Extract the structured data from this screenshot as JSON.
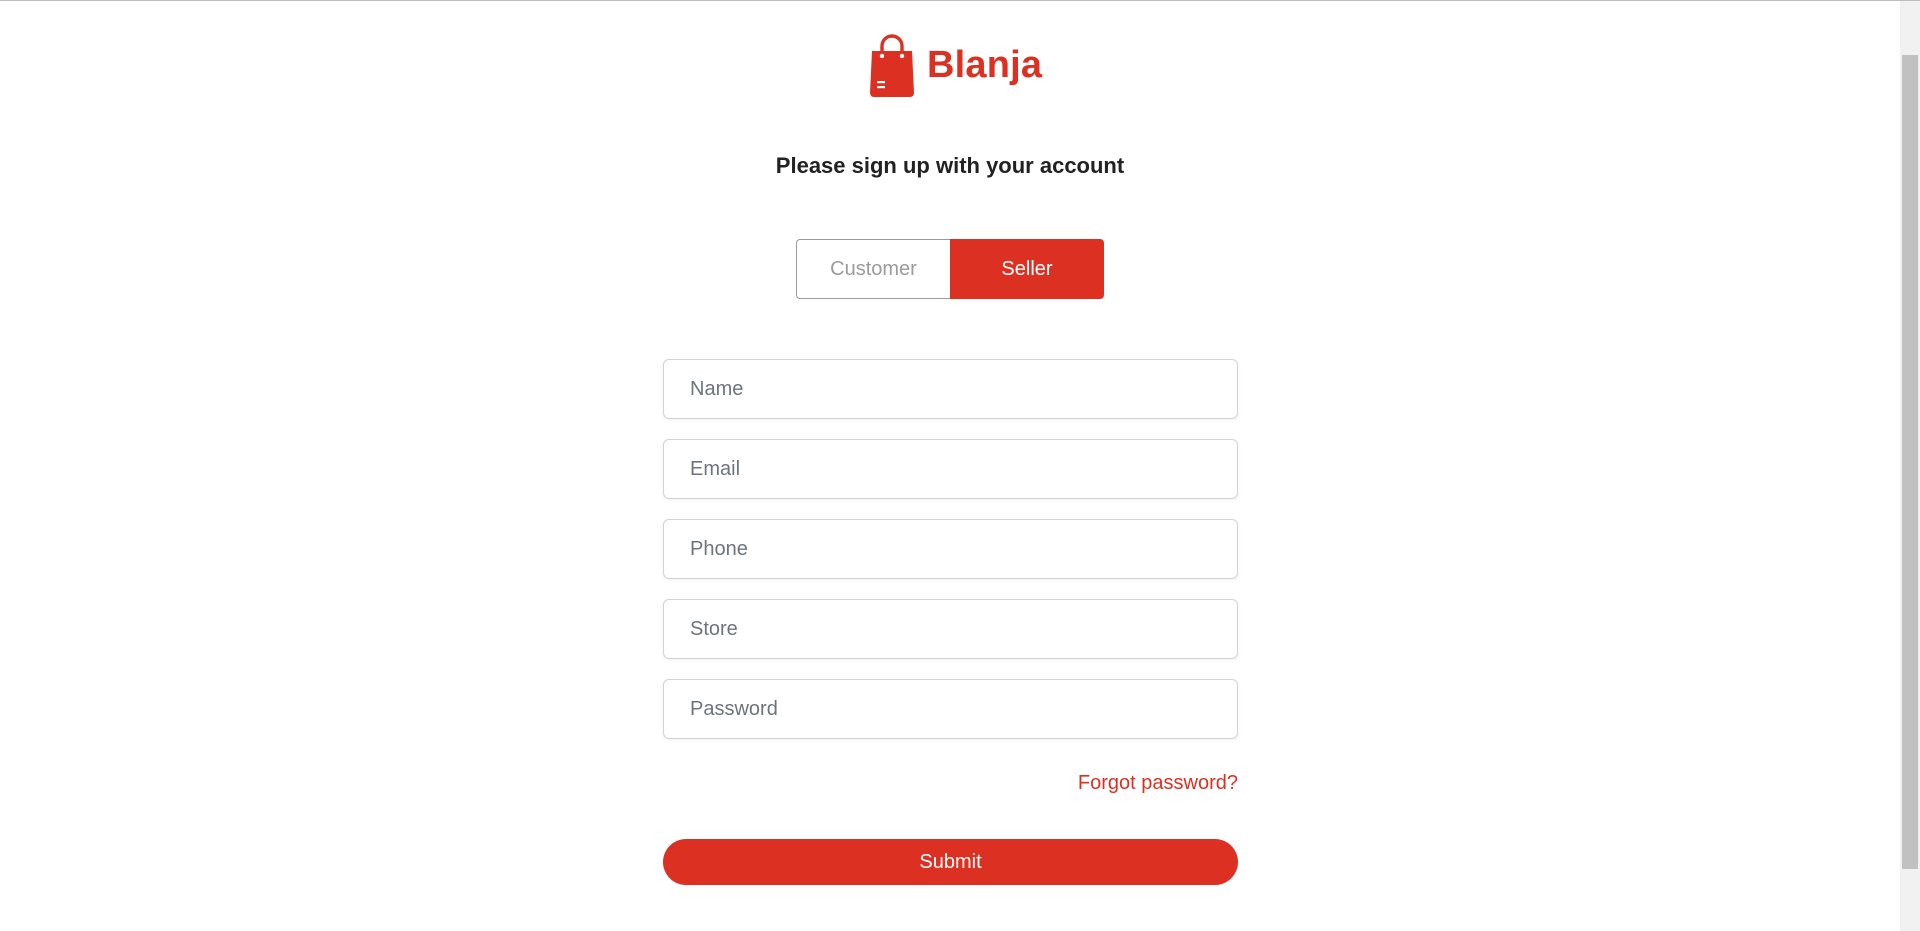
{
  "brand": {
    "name": "Blanja",
    "accent_color": "#db3022",
    "logo_icon": "shopping-bag-icon"
  },
  "heading": "Please sign up with your account",
  "role_toggle": {
    "options": [
      "Customer",
      "Seller"
    ],
    "selected": "Seller"
  },
  "form": {
    "name_placeholder": "Name",
    "email_placeholder": "Email",
    "phone_placeholder": "Phone",
    "store_placeholder": "Store",
    "password_placeholder": "Password",
    "forgot_label": "Forgot password?",
    "submit_label": "Submit"
  }
}
